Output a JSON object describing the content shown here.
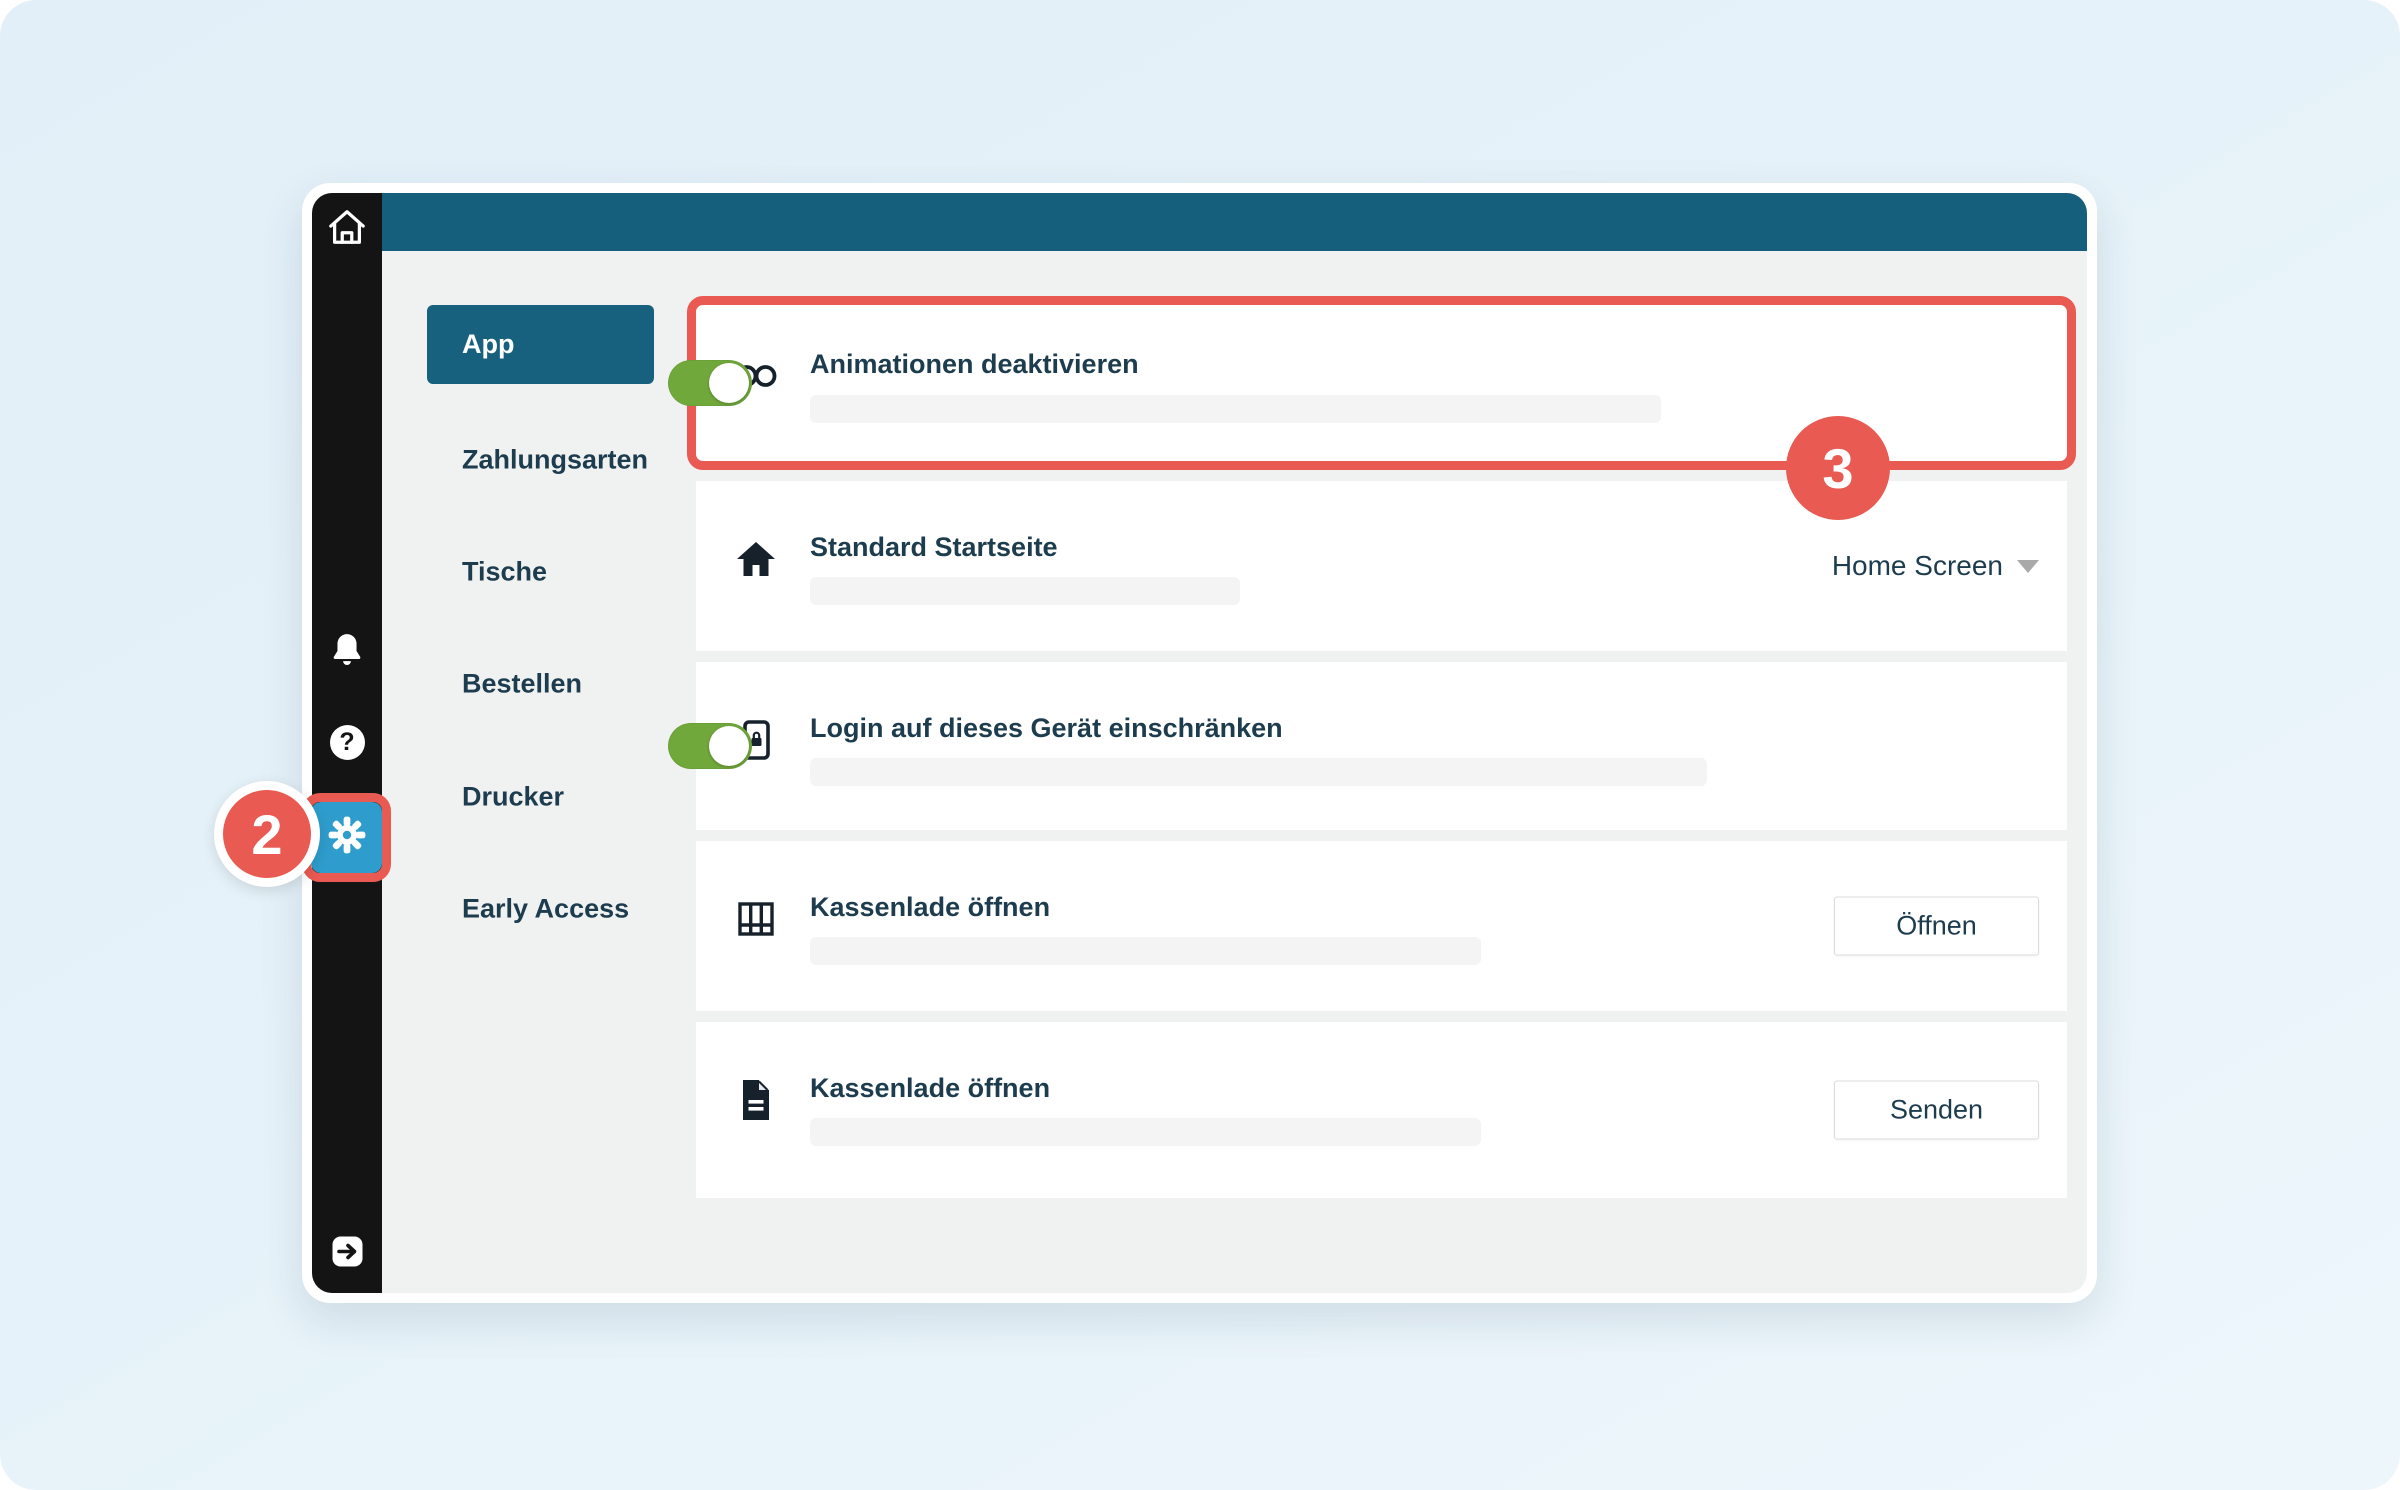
{
  "app": {
    "topbar": {
      "title": ""
    },
    "sidebar": {
      "icons": [
        "home-icon",
        "bell-icon",
        "help-icon",
        "settings-icon",
        "logout-icon"
      ]
    },
    "nav": {
      "items": [
        {
          "label": "App",
          "active": true
        },
        {
          "label": "Zahlungsarten",
          "active": false
        },
        {
          "label": "Tische",
          "active": false
        },
        {
          "label": "Bestellen",
          "active": false
        },
        {
          "label": "Drucker",
          "active": false
        },
        {
          "label": "Early Access",
          "active": false
        }
      ]
    },
    "rows": [
      {
        "icon": "infinity-icon",
        "label": "Animationen deaktivieren",
        "control": "toggle",
        "state": "on",
        "highlighted": true
      },
      {
        "icon": "home-icon",
        "label": "Standard Startseite",
        "control": "select",
        "value": "Home Screen"
      },
      {
        "icon": "device-lock-icon",
        "label": "Login auf dieses Gerät einschränken",
        "control": "toggle",
        "state": "on"
      },
      {
        "icon": "cash-drawer-icon",
        "label": "Kassenlade öffnen",
        "control": "button",
        "button_label": "Öffnen"
      },
      {
        "icon": "document-icon",
        "label": "Kassenlade öffnen",
        "control": "button",
        "button_label": "Senden"
      }
    ]
  },
  "annotations": {
    "step_2": "2",
    "step_3": "3"
  },
  "colors": {
    "header_teal": "#155f7c",
    "nav_active_teal": "#17617f",
    "sidebar_black": "#141414",
    "annotation_red": "#e85a52",
    "toggle_green": "#71a83c",
    "settings_blue": "#2e9dcd",
    "text_dark": "#1d3c4e",
    "content_gray": "#f0f1f1",
    "placeholder_gray": "#f4f4f4",
    "page_blue": "#e4f1f8"
  }
}
